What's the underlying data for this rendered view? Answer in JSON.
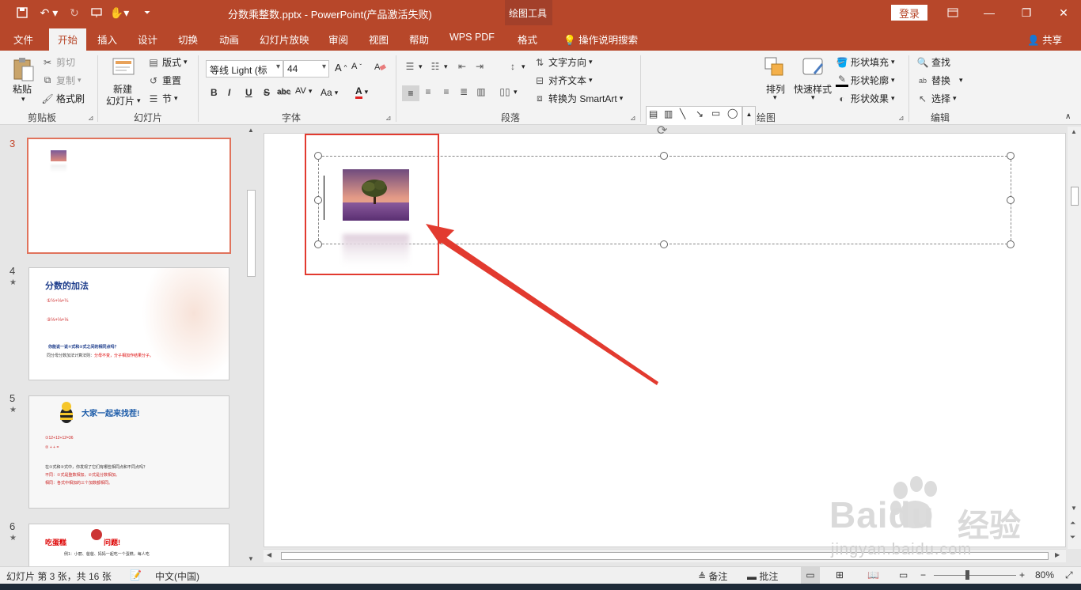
{
  "window": {
    "file_name": "分数乘整数.pptx",
    "app_name": "PowerPoint(产品激活失败)",
    "title": "分数乘整数.pptx  -  PowerPoint(产品激活失败)",
    "context_tab_group": "绘图工具",
    "login_label": "登录"
  },
  "tabs": [
    {
      "label": "文件"
    },
    {
      "label": "开始",
      "active": true
    },
    {
      "label": "插入"
    },
    {
      "label": "设计"
    },
    {
      "label": "切换"
    },
    {
      "label": "动画"
    },
    {
      "label": "幻灯片放映"
    },
    {
      "label": "审阅"
    },
    {
      "label": "视图"
    },
    {
      "label": "帮助"
    },
    {
      "label": "WPS PDF"
    },
    {
      "label": "格式"
    }
  ],
  "tell_me": "操作说明搜索",
  "share_label": "共享",
  "ribbon": {
    "clipboard": {
      "paste": "粘贴",
      "cut": "剪切",
      "copy": "复制",
      "format_painter": "格式刷",
      "group": "剪贴板"
    },
    "slides": {
      "new_slide": "新建",
      "new_slide2": "幻灯片",
      "layout": "版式",
      "reset": "重置",
      "section": "节",
      "group": "幻灯片"
    },
    "font": {
      "font_name": "等线 Light (标",
      "font_size": "44",
      "group": "字体",
      "bold": "B",
      "italic": "I",
      "underline": "U",
      "strike": "S",
      "shadow": "abc",
      "spacing": "AV",
      "case": "Aa",
      "color": "A"
    },
    "paragraph": {
      "text_direction": "文字方向",
      "align_text": "对齐文本",
      "smartart": "转换为 SmartArt",
      "group": "段落"
    },
    "drawing": {
      "arrange": "排列",
      "quick_styles": "快速样式",
      "shape_fill": "形状填充",
      "shape_outline": "形状轮廓",
      "shape_effects": "形状效果",
      "group": "绘图"
    },
    "editing": {
      "find": "查找",
      "replace": "替换",
      "select": "选择",
      "group": "编辑"
    }
  },
  "slides": [
    {
      "number": "3",
      "star": "",
      "selected": true
    },
    {
      "number": "4",
      "star": "★",
      "title": "分数的加法",
      "footer": "同分母分数加法计算法则：",
      "footer_red": "分母不变，分子相加作结果分子。"
    },
    {
      "number": "5",
      "star": "★",
      "title": "大家一起来找茬!",
      "lines": [
        "①12+12+12=36",
        "②  +  +  =",
        "在①式和②式中，你发现了它们有哪些相同点和不同点吗？",
        "不同：①式是整数相加，②式是分数相加。",
        "相同：各式中相加的三个加数都相同。"
      ]
    },
    {
      "number": "6",
      "star": "★",
      "title": "吃蛋糕",
      "title2": "问题!",
      "line": "例1：小丽、爸爸、妈妈一起吃一个蛋糕，每人吃"
    }
  ],
  "status": {
    "slide_info": "幻灯片 第 3 张，共 16 张",
    "language": "中文(中国)",
    "notes": "备注",
    "comments": "批注",
    "zoom": "80%",
    "zoom_level": 0.8
  },
  "watermark": {
    "brand": "Baidu",
    "cn": "经验",
    "url": "jingyan.baidu.com"
  },
  "colors": {
    "accent": "#b7472a",
    "selected_border": "#e0735c",
    "annotation_red": "#e23a2f"
  }
}
